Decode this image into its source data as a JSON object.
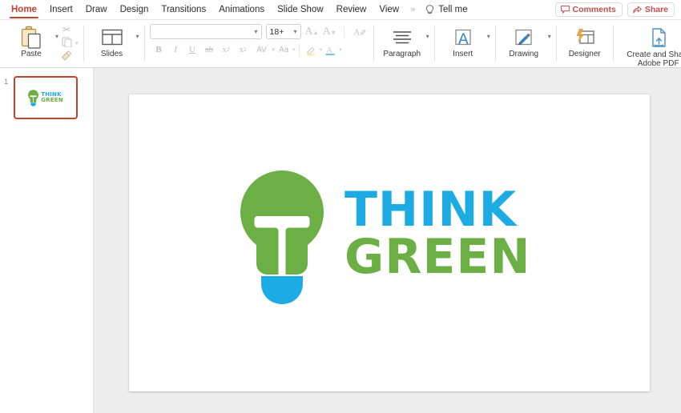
{
  "colors": {
    "accent_red": "#c24230",
    "logo_green": "#6BAF45",
    "logo_blue": "#1CABE3",
    "workspace_gray": "#ededed"
  },
  "menubar": {
    "tabs": [
      {
        "label": "Home",
        "active": true
      },
      {
        "label": "Insert",
        "active": false
      },
      {
        "label": "Draw",
        "active": false
      },
      {
        "label": "Design",
        "active": false
      },
      {
        "label": "Transitions",
        "active": false
      },
      {
        "label": "Animations",
        "active": false
      },
      {
        "label": "Slide Show",
        "active": false
      },
      {
        "label": "Review",
        "active": false
      },
      {
        "label": "View",
        "active": false
      }
    ],
    "overflow": "»",
    "tell_me": "Tell me",
    "comments_label": "Comments",
    "share_label": "Share"
  },
  "ribbon": {
    "paste_label": "Paste",
    "cut_icon": "scissors-icon",
    "copy_icon": "copy-icon",
    "format_painter_icon": "paintbrush-icon",
    "slides_label": "Slides",
    "font_name": "",
    "font_name_placeholder": "",
    "font_size": "18+",
    "grow_font_label": "A",
    "shrink_font_label": "A",
    "clear_formatting_label": "A",
    "bold_label": "B",
    "italic_label": "I",
    "underline_label": "U",
    "strikethrough_label": "ab",
    "superscript_label": "x",
    "subscript_label": "x",
    "char_spacing_label": "AV",
    "change_case_label": "Aa",
    "highlight_label": "✎",
    "font_color_label": "A",
    "paragraph_label": "Paragraph",
    "insert_label": "Insert",
    "drawing_label": "Drawing",
    "designer_label": "Designer",
    "pdf_label_line1": "Create and Share",
    "pdf_label_line2": "Adobe PDF"
  },
  "thumbnails": {
    "slides": [
      {
        "number": "1",
        "selected": true,
        "title_line1": "THINK",
        "title_line2": "GREEN"
      }
    ]
  },
  "slide": {
    "logo": {
      "icon_name": "lightbulb-tree-icon",
      "word_line1": "THINK",
      "word_line2": "GREEN"
    }
  }
}
